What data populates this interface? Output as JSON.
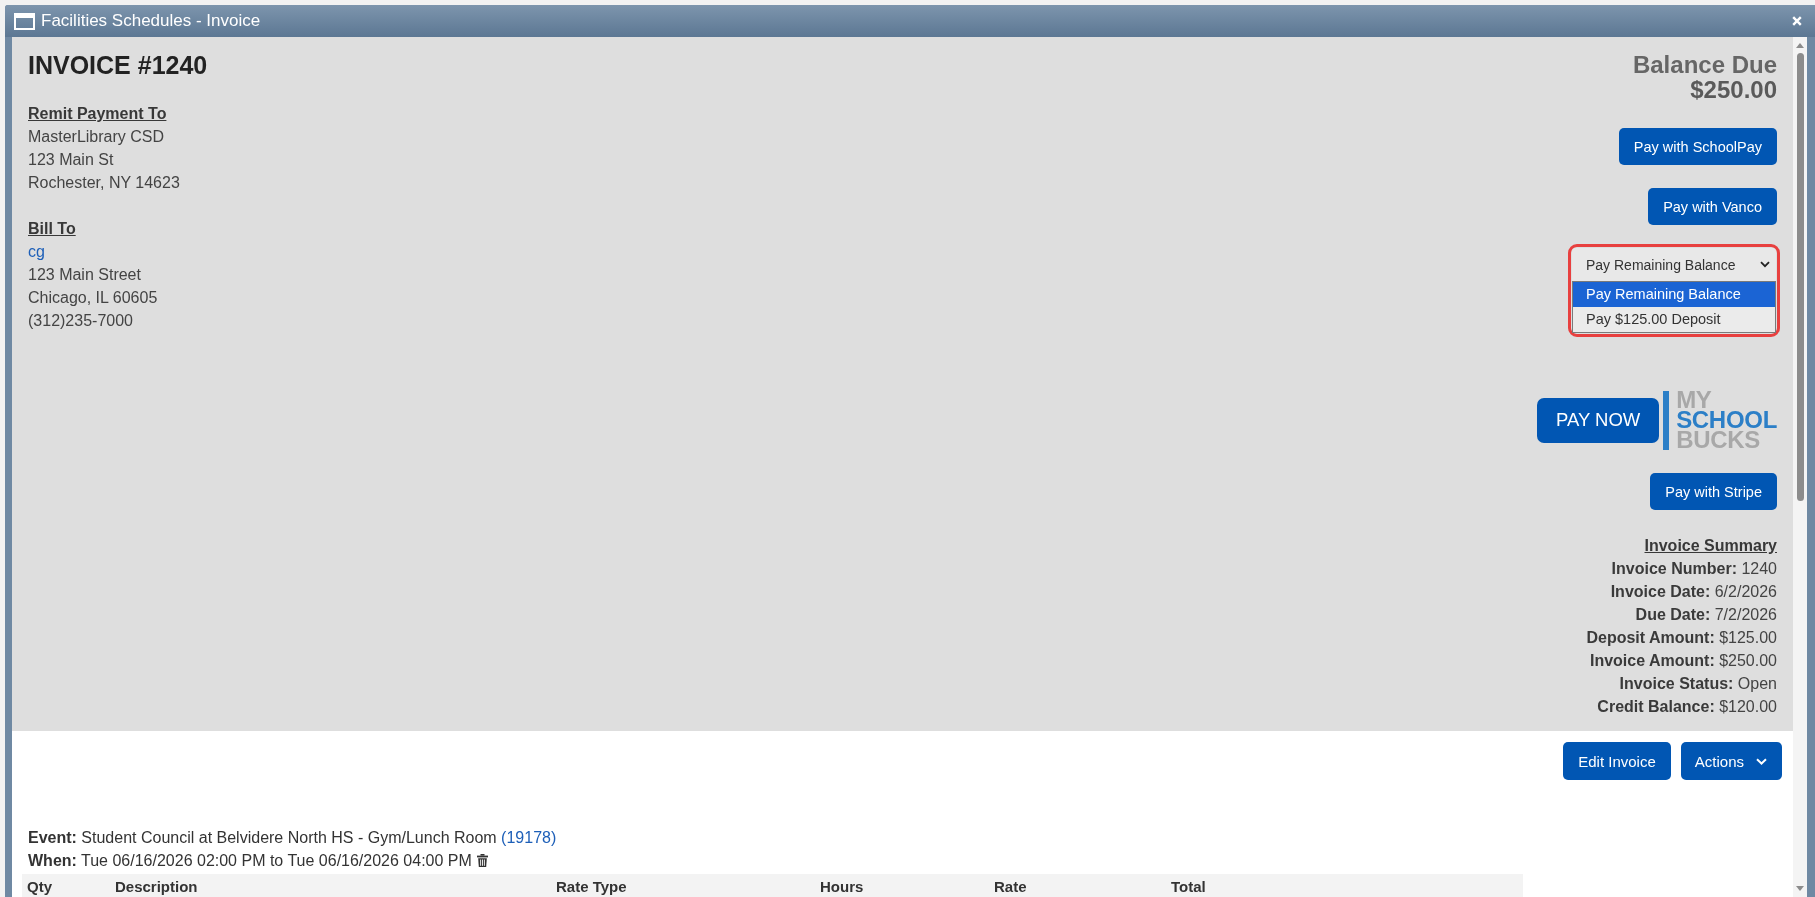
{
  "window": {
    "title": "Facilities Schedules - Invoice"
  },
  "invoice": {
    "heading": "INVOICE #1240",
    "remit_to": {
      "label": "Remit Payment To",
      "lines": [
        "MasterLibrary CSD",
        "123 Main St",
        "Rochester, NY 14623"
      ]
    },
    "bill_to": {
      "label": "Bill To",
      "name": "cg",
      "lines": [
        "123 Main Street",
        "Chicago, IL 60605",
        "(312)235-7000"
      ]
    }
  },
  "balance": {
    "label": "Balance Due",
    "amount": "$250.00"
  },
  "payment_methods": [
    {
      "kind": "button",
      "label": "Pay with SchoolPay"
    },
    {
      "kind": "button",
      "label": "Pay with Vanco"
    },
    {
      "kind": "amount_select",
      "value": "Pay Remaining Balance",
      "expanded": true,
      "highlighted": true,
      "options": [
        {
          "label": "Pay Remaining Balance",
          "selected": true
        },
        {
          "label": "Pay $125.00 Deposit",
          "selected": false
        }
      ]
    },
    {
      "kind": "logo_button",
      "label": "PAY NOW",
      "logo": [
        {
          "text": "MY",
          "color": "#a8a8a8"
        },
        {
          "text": "SCHOOL",
          "color": "#2c7fc7"
        },
        {
          "text": "BUCKS",
          "color": "#a8a8a8"
        }
      ]
    },
    {
      "kind": "button",
      "label": "Pay with Stripe"
    }
  ],
  "summary": {
    "title": "Invoice Summary",
    "rows": [
      "**Invoice Number:** 1240",
      "**Invoice Date:** 6/2/2026",
      "**Due Date:** 7/2/2026",
      "**Deposit Amount:** $125.00",
      "**Invoice Amount:** $250.00",
      "**Invoice Status:** Open",
      "**Credit Balance:** $120.00"
    ]
  },
  "actions": [
    {
      "kind": "button",
      "label": "Edit Invoice"
    },
    {
      "kind": "menu_button",
      "label": "Actions"
    }
  ],
  "event": {
    "text": "**Event:** Student Council at Belvidere North HS - Gym/Lunch Room",
    "link": "(19178)"
  },
  "when": {
    "text": "**When:** Tue 06/16/2026 02:00 PM to Tue 06/16/2026 04:00 PM"
  },
  "table": {
    "columns": [
      "Qty",
      "Description",
      "Rate Type",
      "Hours",
      "Rate",
      "Total"
    ]
  }
}
